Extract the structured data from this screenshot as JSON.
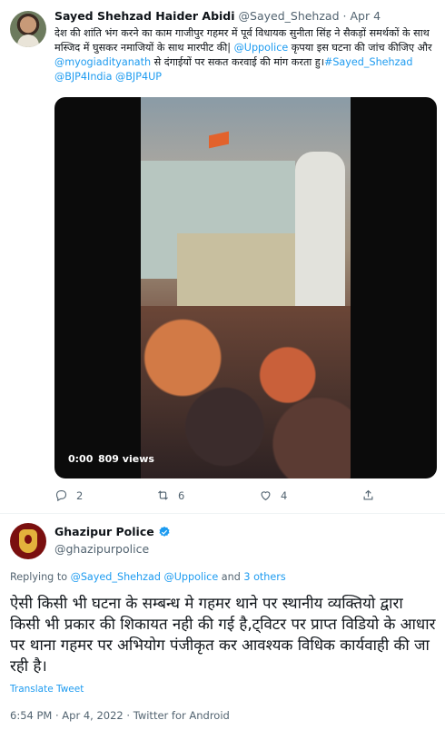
{
  "tweet1": {
    "author_name": "Sayed Shehzad Haider Abidi",
    "handle": "@Sayed_Shehzad",
    "separator": "·",
    "date": "Apr 4",
    "text_a": "देश की शांति भंग करने का काम गाजीपुर गहमर में पूर्व विधायक सुनीता सिंह ने सैकड़ों समर्थकों के साथ मस्जिद में घुसकर नमाजियों के साथ मारपीट की| ",
    "mention1": "@Uppolice",
    "text_b": " कृपया इस घटना की जांच कीजिए और ",
    "mention2": "@myogiadityanath",
    "text_c": " से दंगाईयों पर सकत करवाई की मांग करता हु।",
    "tags": "#Sayed_Shehzad @BJP4India @BJP4UP",
    "video_time": "0:00",
    "video_views": "809 views",
    "replies": "2",
    "retweets": "6",
    "likes": "4"
  },
  "tweet2": {
    "author_name": "Ghazipur Police",
    "handle": "@ghazipurpolice",
    "replying_prefix": "Replying to ",
    "replying_mentions": "@Sayed_Shehzad @Uppolice",
    "replying_suffix": " and ",
    "replying_others": "3 others",
    "text": "ऐसी किसी भी घटना के सम्बन्ध मे गहमर थाने पर स्थानीय व्यक्तियो द्वारा किसी भी प्रकार की शिकायत नही की गई है,ट्विटर पर प्राप्त विडियो के आधार पर थाना गहमर पर अभियोग पंजीकृत कर आवश्यक विधिक कार्यवाही की जा रही है।",
    "translate": "Translate Tweet",
    "meta": "6:54 PM · Apr 4, 2022 · Twitter for Android"
  },
  "colors": {
    "accent": "#1d9bf0",
    "muted": "#536471"
  },
  "icons": [
    "reply-icon",
    "retweet-icon",
    "like-icon",
    "share-icon",
    "verified-badge-icon"
  ]
}
